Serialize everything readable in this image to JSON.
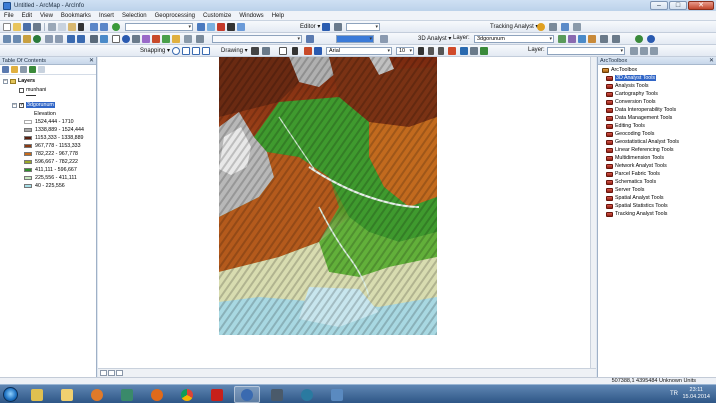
{
  "window": {
    "title": "Untitled - ArcMap - ArcInfo"
  },
  "menu": [
    "File",
    "Edit",
    "View",
    "Bookmarks",
    "Insert",
    "Selection",
    "Geoprocessing",
    "Customize",
    "Windows",
    "Help"
  ],
  "toolbar": {
    "editor_label": "Editor ▾",
    "tracking_label": "Tracking Analyst ▾",
    "analyst3d_label": "3D Analyst ▾",
    "layer_label": "Layer:",
    "layer_value": "3dgorunum",
    "snapping_label": "Snapping ▾",
    "drawing_label": "Drawing ▾",
    "font_name": "Arial",
    "font_size": "10",
    "layer2_label": "Layer:"
  },
  "toc": {
    "title": "Table Of Contents",
    "root_label": "Layers",
    "layer1": "munhani",
    "layer2": "3dgorunum",
    "field": "Elevation",
    "classes": [
      {
        "label": "1524,444 - 1710",
        "color": "#ffffff"
      },
      {
        "label": "1338,889 - 1524,444",
        "color": "#a8a8a8"
      },
      {
        "label": "1153,333 - 1338,889",
        "color": "#5a1f0f"
      },
      {
        "label": "967,778 - 1153,333",
        "color": "#8a3a12"
      },
      {
        "label": "782,222 - 967,778",
        "color": "#c86a18"
      },
      {
        "label": "596,667 - 782,222",
        "color": "#9aa828"
      },
      {
        "label": "411,111 - 596,667",
        "color": "#2e8f2a"
      },
      {
        "label": "225,556 - 411,111",
        "color": "#c8e8c0"
      },
      {
        "label": "40 - 225,556",
        "color": "#a8e0e8"
      }
    ]
  },
  "arctoolbox": {
    "title": "ArcToolbox",
    "root": "ArcToolbox",
    "items": [
      "3D Analyst Tools",
      "Analysis Tools",
      "Cartography Tools",
      "Conversion Tools",
      "Data Interoperability Tools",
      "Data Management Tools",
      "Editing Tools",
      "Geocoding Tools",
      "Geostatistical Analyst Tools",
      "Linear Referencing Tools",
      "Multidimension Tools",
      "Network Analyst Tools",
      "Parcel Fabric Tools",
      "Schematics Tools",
      "Server Tools",
      "Spatial Analyst Tools",
      "Spatial Statistics Tools",
      "Tracking Analyst Tools"
    ]
  },
  "status": {
    "coords": "507388,1  4395484 Unknown Units"
  },
  "taskbar": {
    "time": "23:11",
    "date": "15.04.2014",
    "lang": "TR"
  },
  "colors": {
    "accent": "#3166c7",
    "toolbox_icon": "#b3352a"
  }
}
